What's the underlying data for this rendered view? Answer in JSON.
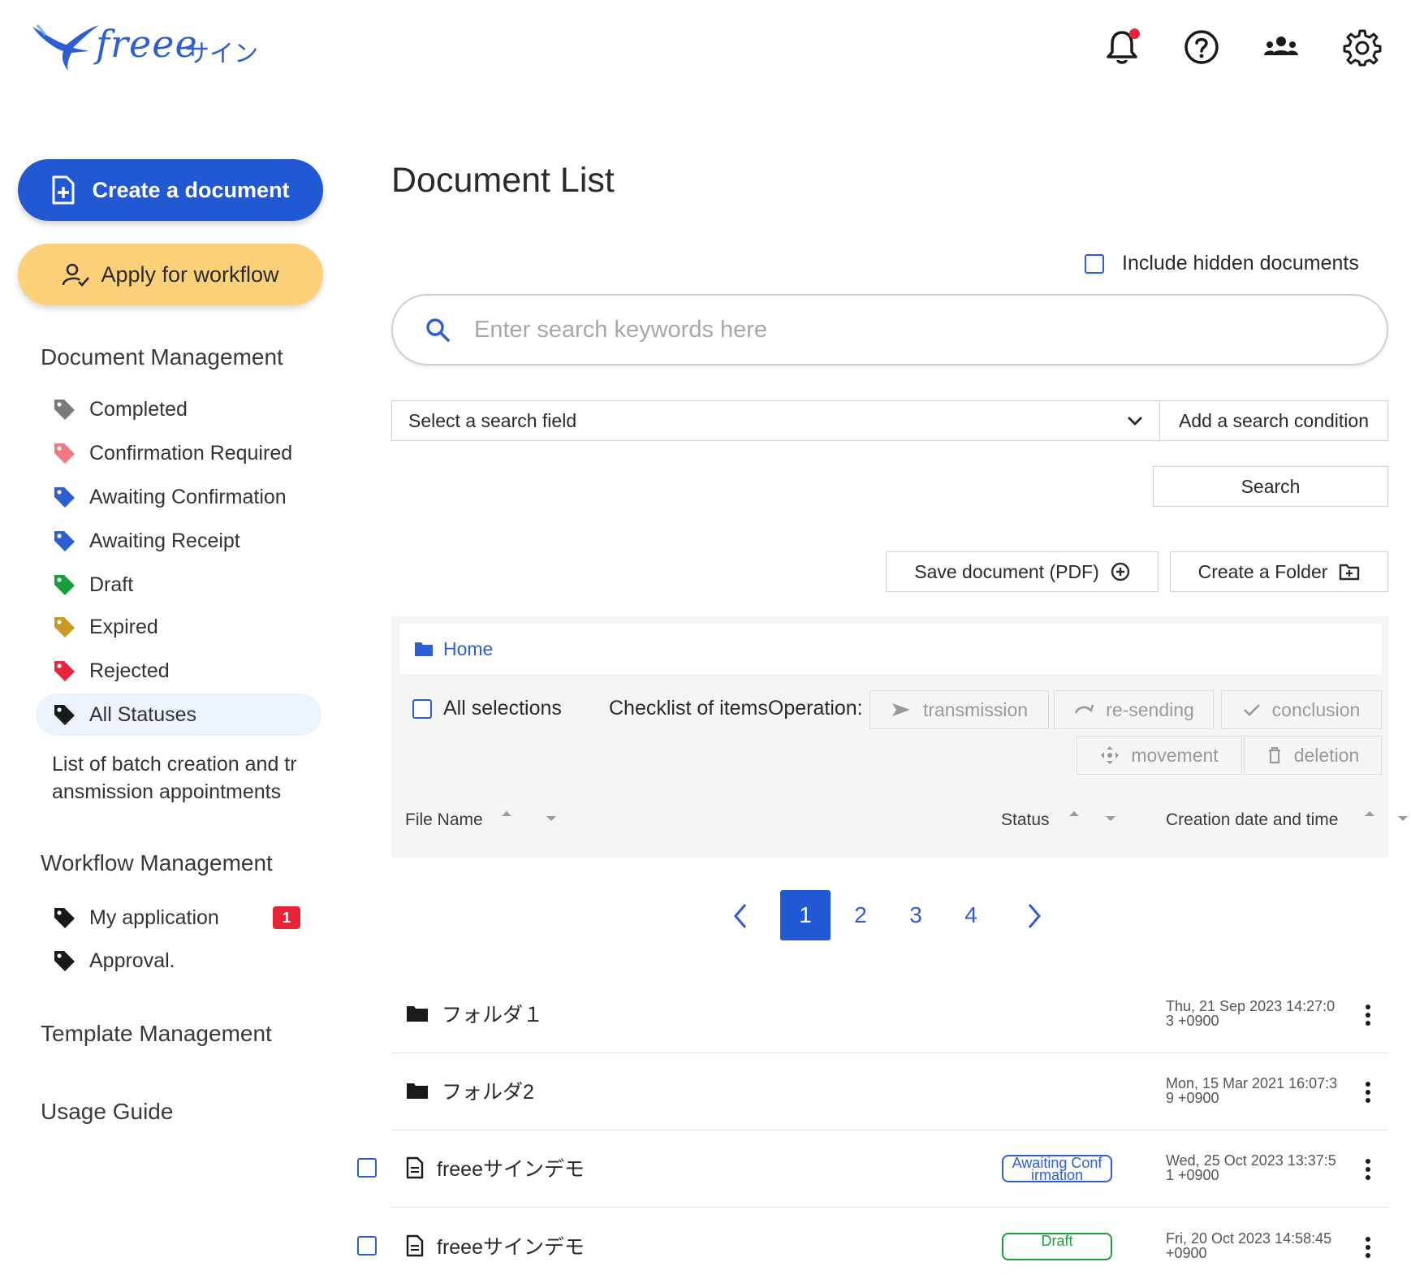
{
  "brand": {
    "name": "freee",
    "product_kana": "サイン",
    "color": "#2d5fd3"
  },
  "header": {
    "icons": [
      "bell-icon",
      "help-icon",
      "team-icon",
      "gear-icon"
    ],
    "notification_dot_color": "#e8243a"
  },
  "sidebar": {
    "create_label": "Create a document",
    "workflow_label": "Apply for workflow",
    "doc_mgmt_title": "Document Management",
    "statuses": [
      {
        "label": "Completed",
        "color": "#7a7a7a"
      },
      {
        "label": "Confirmation Required",
        "color": "#f07a84"
      },
      {
        "label": "Awaiting Confirmation",
        "color": "#2d5fd3"
      },
      {
        "label": "Awaiting Receipt",
        "color": "#2d5fd3"
      },
      {
        "label": "Draft",
        "color": "#1a9e3c"
      },
      {
        "label": "Expired",
        "color": "#c99a22"
      },
      {
        "label": "Rejected",
        "color": "#e8243a"
      },
      {
        "label": "All Statuses",
        "color": "#1a1a1a",
        "active": true
      }
    ],
    "batch_link": "List of batch creation and tr ansmission appointments",
    "workflow_title": "Workflow Management",
    "workflow_items": [
      {
        "label": "My application",
        "badge": "1"
      },
      {
        "label": "Approval."
      }
    ],
    "template_title": "Template Management",
    "guide_title": "Usage Guide"
  },
  "main": {
    "title": "Document List",
    "include_hidden_label": "Include hidden documents",
    "search_placeholder": "Enter search keywords here",
    "search_field_select": "Select a search field",
    "add_condition_label": "Add a search condition",
    "search_button": "Search",
    "save_pdf_label": "Save document (PDF)",
    "create_folder_label": "Create a Folder",
    "breadcrumb_home": "Home",
    "all_selections_label": "All selections",
    "checklist_label": "Checklist of itemsOperation:",
    "operations": [
      "transmission",
      "re-sending",
      "conclusion",
      "movement",
      "deletion"
    ],
    "columns": {
      "file_name": "File Name",
      "status": "Status",
      "created": "Creation date and time"
    },
    "pagination": {
      "pages": [
        "1",
        "2",
        "3",
        "4"
      ],
      "current": "1"
    },
    "rows": [
      {
        "type": "folder",
        "name": "フォルダ１",
        "status": "",
        "date": "Thu, 21 Sep 2023 14:27:0 3 +0900"
      },
      {
        "type": "folder",
        "name": "フォルダ2",
        "status": "",
        "date": "Mon, 15 Mar 2021 16:07:3 9 +0900"
      },
      {
        "type": "file",
        "name": "freeeサインデモ",
        "status": "Awaiting Conf irmation",
        "status_color": "#2d5fd3",
        "date": "Wed, 25 Oct 2023 13:37:5 1 +0900"
      },
      {
        "type": "file",
        "name": "freeeサインデモ",
        "status": "Draft",
        "status_color": "#1a9e3c",
        "date": "Fri, 20 Oct 2023 14:58:45 +0900"
      }
    ]
  }
}
